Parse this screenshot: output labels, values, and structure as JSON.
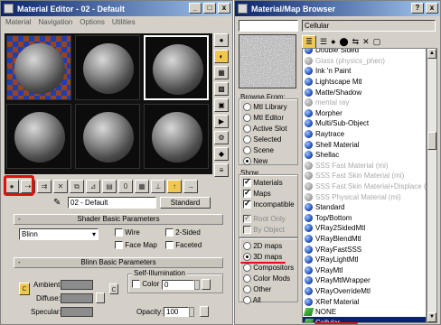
{
  "editor": {
    "title": "Material Editor - 02 - Default",
    "menu": [
      "Material",
      "Navigation",
      "Options",
      "Utilities"
    ],
    "win_buttons": [
      "_",
      "□",
      "x"
    ],
    "material_name": "02 - Default",
    "type_button": "Standard",
    "shader_rollout": "Shader Basic Parameters",
    "shader_type": "Blinn",
    "wire": "Wire",
    "two_sided": "2-Sided",
    "face_map": "Face Map",
    "faceted": "Faceted",
    "blinn_rollout": "Blinn Basic Parameters",
    "self_illum": "Self-Illumination",
    "color_label": "Color",
    "color_value": "0",
    "ambient": "Ambient:",
    "diffuse": "Diffuse:",
    "specular": "Specular:",
    "opacity_label": "Opacity:",
    "opacity_value": "100",
    "rollout_marker": "-",
    "lock_glyph": "C"
  },
  "browser": {
    "title": "Material/Map Browser",
    "win_buttons": [
      "?",
      "x"
    ],
    "selected_name": "Cellular",
    "browse_from": {
      "title": "Browse From:",
      "options": [
        "Mtl Library",
        "Mtl Editor",
        "Active Slot",
        "Selected",
        "Scene",
        "New"
      ],
      "selected": "New"
    },
    "show": {
      "title": "Show",
      "materials": "Materials",
      "maps": "Maps",
      "incompatible": "Incompatible",
      "root_only": "Root Only",
      "by_object": "By Object"
    },
    "map_types": [
      "2D maps",
      "3D maps",
      "Compositors",
      "Color Mods",
      "Other",
      "All"
    ],
    "map_selected": "3D maps",
    "items": [
      {
        "label": "Double Sided",
        "kind": "mtl"
      },
      {
        "label": "Glass (physics_phen)",
        "kind": "mtl-grey"
      },
      {
        "label": "Ink 'n Paint",
        "kind": "mtl"
      },
      {
        "label": "Lightscape Mtl",
        "kind": "mtl"
      },
      {
        "label": "Matte/Shadow",
        "kind": "mtl"
      },
      {
        "label": "mental ray",
        "kind": "mtl-grey"
      },
      {
        "label": "Morpher",
        "kind": "mtl"
      },
      {
        "label": "Multi/Sub-Object",
        "kind": "mtl"
      },
      {
        "label": "Raytrace",
        "kind": "mtl"
      },
      {
        "label": "Shell Material",
        "kind": "mtl"
      },
      {
        "label": "Shellac",
        "kind": "mtl"
      },
      {
        "label": "SSS Fast Material (mi)",
        "kind": "mtl-grey"
      },
      {
        "label": "SSS Fast Skin Material (mi)",
        "kind": "mtl-grey"
      },
      {
        "label": "SSS Fast Skin Material+Displace (mi)",
        "kind": "mtl-grey"
      },
      {
        "label": "SSS Physical Material (mi)",
        "kind": "mtl-grey"
      },
      {
        "label": "Standard",
        "kind": "mtl"
      },
      {
        "label": "Top/Bottom",
        "kind": "mtl"
      },
      {
        "label": "VRay2SidedMtl",
        "kind": "mtl"
      },
      {
        "label": "VRayBlendMtl",
        "kind": "mtl"
      },
      {
        "label": "VRayFastSSS",
        "kind": "mtl"
      },
      {
        "label": "VRayLightMtl",
        "kind": "mtl"
      },
      {
        "label": "VRayMtl",
        "kind": "mtl"
      },
      {
        "label": "VRayMtlWrapper",
        "kind": "mtl"
      },
      {
        "label": "VRayOverrideMtl",
        "kind": "mtl"
      },
      {
        "label": "XRef Material",
        "kind": "mtl"
      },
      {
        "label": "NONE",
        "kind": "map"
      },
      {
        "label": "Cellular",
        "kind": "map"
      }
    ]
  },
  "colors": {
    "highlight": "#e01010",
    "title_bar": "#0a246a",
    "panel": "#d4d0c8"
  }
}
